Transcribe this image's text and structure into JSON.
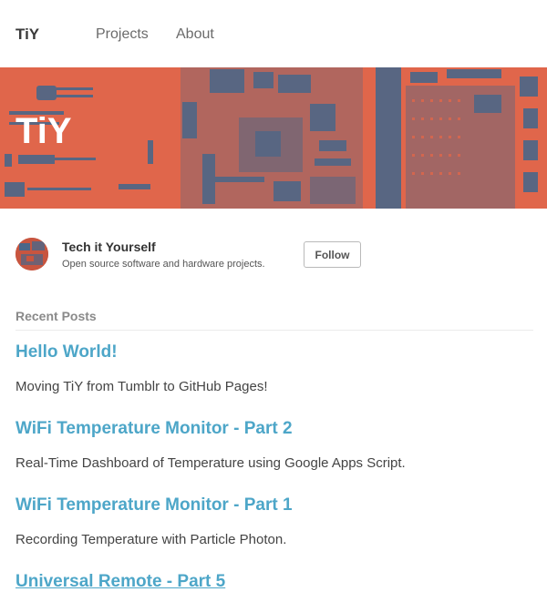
{
  "nav": {
    "brand": "TiY",
    "links": [
      "Projects",
      "About"
    ]
  },
  "banner": {
    "title": "TiY",
    "background_color": "#e0664b",
    "pattern_color": "#4a6789"
  },
  "profile": {
    "name": "Tech it Yourself",
    "description": "Open source software and hardware projects.",
    "follow_label": "Follow"
  },
  "recent_posts": {
    "heading": "Recent Posts",
    "posts": [
      {
        "title": "Hello World!",
        "excerpt": "Moving TiY from Tumblr to GitHub Pages!"
      },
      {
        "title": "WiFi Temperature Monitor - Part 2",
        "excerpt": "Real-Time Dashboard of Temperature using Google Apps Script."
      },
      {
        "title": "WiFi Temperature Monitor - Part 1",
        "excerpt": "Recording Temperature with Particle Photon."
      },
      {
        "title": "Universal Remote - Part 5",
        "excerpt": ""
      }
    ]
  },
  "colors": {
    "link": "#4da6c8",
    "text": "#444444",
    "muted": "#8a8a8a"
  }
}
